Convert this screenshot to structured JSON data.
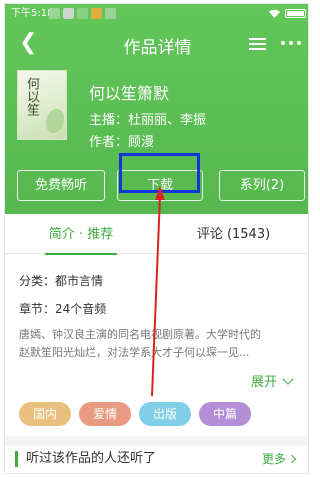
{
  "status_bar": {
    "time": "下午5:18",
    "icons": [
      "image-icon",
      "app-icon",
      "chat-icon",
      "alarm-icon",
      "message-icon"
    ],
    "signal": "wifi-icon",
    "battery_icon": "battery-icon"
  },
  "header": {
    "title": "作品详情",
    "back_icon": "back-arrow-icon",
    "menu_icon": "list-icon",
    "more_icon": "more-dots-icon"
  },
  "book": {
    "cover_text": "何以笙",
    "title": "何以笙箫默",
    "narrator": "主播：杜丽丽、李振",
    "author": "作者：顾漫"
  },
  "actions": {
    "free_listen": "免费畅听",
    "download": "下载",
    "series": "系列(2)"
  },
  "tabs": {
    "intro": "简介 · 推荐",
    "comments": "评论 (1543)"
  },
  "details": {
    "category": "分类：都市言情",
    "chapters": "章节：24个音频",
    "description_line1": "唐嫣、钟汉良主演的同名电视剧原著。大学时代的",
    "description_line2": "赵默笙阳光灿烂，对法学系大才子何以琛一见..."
  },
  "expand_label": "展开",
  "tags": [
    "国内",
    "爱情",
    "出版",
    "中篇"
  ],
  "related": {
    "title": "听过该作品的人还听了",
    "more": "更多"
  },
  "colors": {
    "brand_green": "#5bbd54",
    "accent_green": "#3fae3c",
    "highlight_blue": "#1236d8",
    "arrow_red": "#d8241f"
  }
}
